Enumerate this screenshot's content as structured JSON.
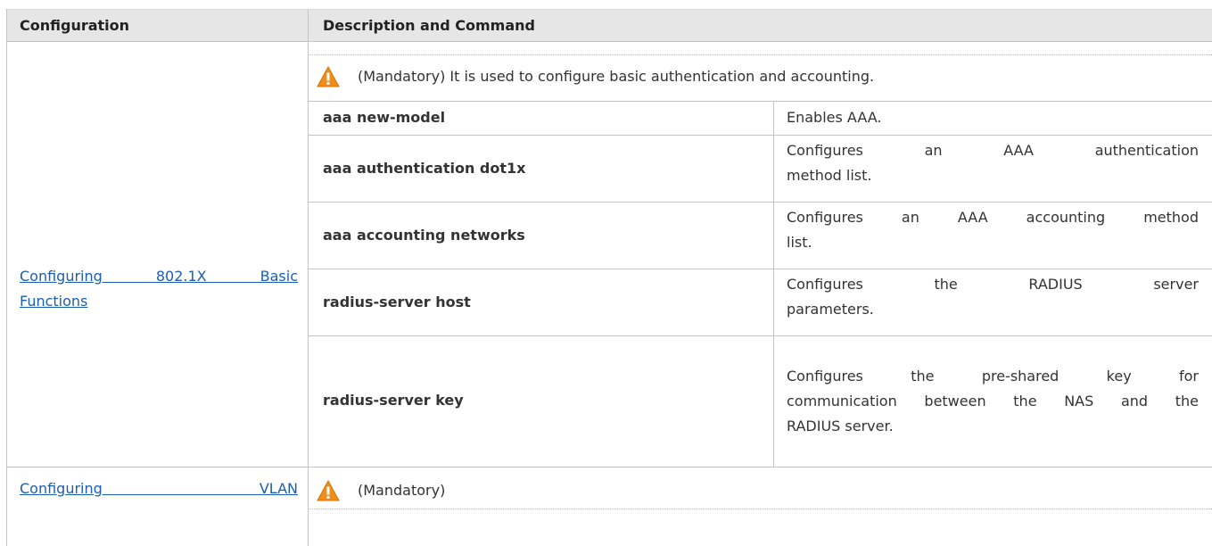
{
  "header": {
    "col1": "Configuration",
    "col2": "Description and Command"
  },
  "sections": [
    {
      "config_link_line1": "Configuring 802.1X Basic",
      "config_link_line2": "Functions",
      "note_text": "(Mandatory) It is used to configure basic authentication and accounting.",
      "commands": [
        {
          "command": "aaa new-model",
          "desc_lines": [
            "Enables AAA."
          ]
        },
        {
          "command": "aaa authentication dot1x",
          "desc_lines": [
            "Configures an AAA authentication",
            "method list."
          ]
        },
        {
          "command": "aaa accounting networks",
          "desc_lines": [
            "Configures an AAA accounting method",
            "list."
          ]
        },
        {
          "command": "radius-server host",
          "desc_lines": [
            "Configures the RADIUS server",
            "parameters."
          ]
        },
        {
          "command": "radius-server key",
          "desc_lines": [
            "Configures the pre-shared key for",
            "communication between the NAS and the",
            "RADIUS server."
          ]
        }
      ]
    },
    {
      "config_link_line1": "Configuring VLAN",
      "note_text": "(Mandatory)"
    }
  ],
  "icons": {
    "warning": "warning-icon"
  },
  "colors": {
    "header_bg": "#e6e6e6",
    "link": "#1a5fb4",
    "warning": "#f08c1a"
  }
}
